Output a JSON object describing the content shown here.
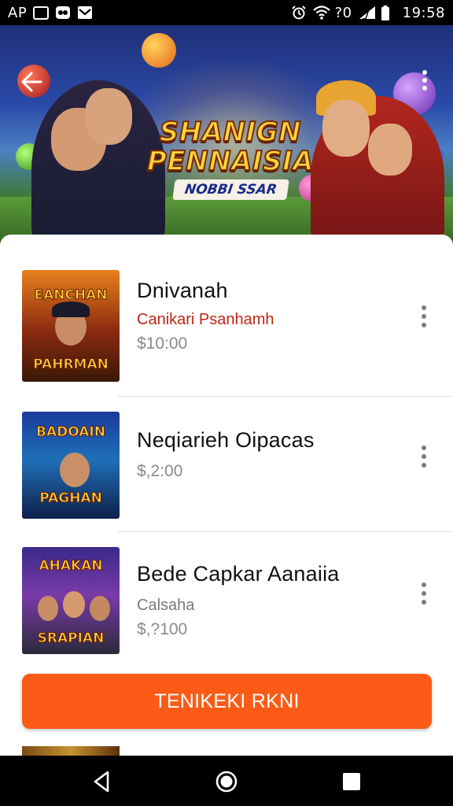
{
  "status_bar": {
    "left_text": "AP",
    "signal_text": "?0",
    "time": "19:58"
  },
  "hero": {
    "title_line_1": "SHANIGN",
    "title_line_2": "PENNAISIA",
    "subtitle": "NOBBI SSAR"
  },
  "items": [
    {
      "title": "Dnivanah",
      "subtitle": "Canikari Psanhamh",
      "subtitle_color": "#c02616",
      "price": "$10:00",
      "thumb_top": "EANCHAN",
      "thumb_bottom": "PAHRMAN"
    },
    {
      "title": "Neqiarieh Oipacas",
      "subtitle": "",
      "subtitle_color": "#7a7a7a",
      "price": "$,2:00",
      "thumb_top": "BADOAIN",
      "thumb_bottom": "PAGHAN"
    },
    {
      "title": "Bede Capkar Aanaiia",
      "subtitle": "Calsaha",
      "subtitle_color": "#7a7a7a",
      "price": "$,?100",
      "thumb_top": "AHAKAN",
      "thumb_bottom": "SRAPIAN"
    }
  ],
  "cta": {
    "label": "TENIKEKI RKNI"
  },
  "colors": {
    "accent": "#fb5b17",
    "status_bar": "#000000",
    "nav_bar": "#000000"
  },
  "icons": {
    "back": "arrow-left-icon",
    "overflow": "kebab-icon",
    "nav_back": "triangle-back-icon",
    "nav_home": "circle-home-icon",
    "nav_recents": "square-recents-icon"
  }
}
